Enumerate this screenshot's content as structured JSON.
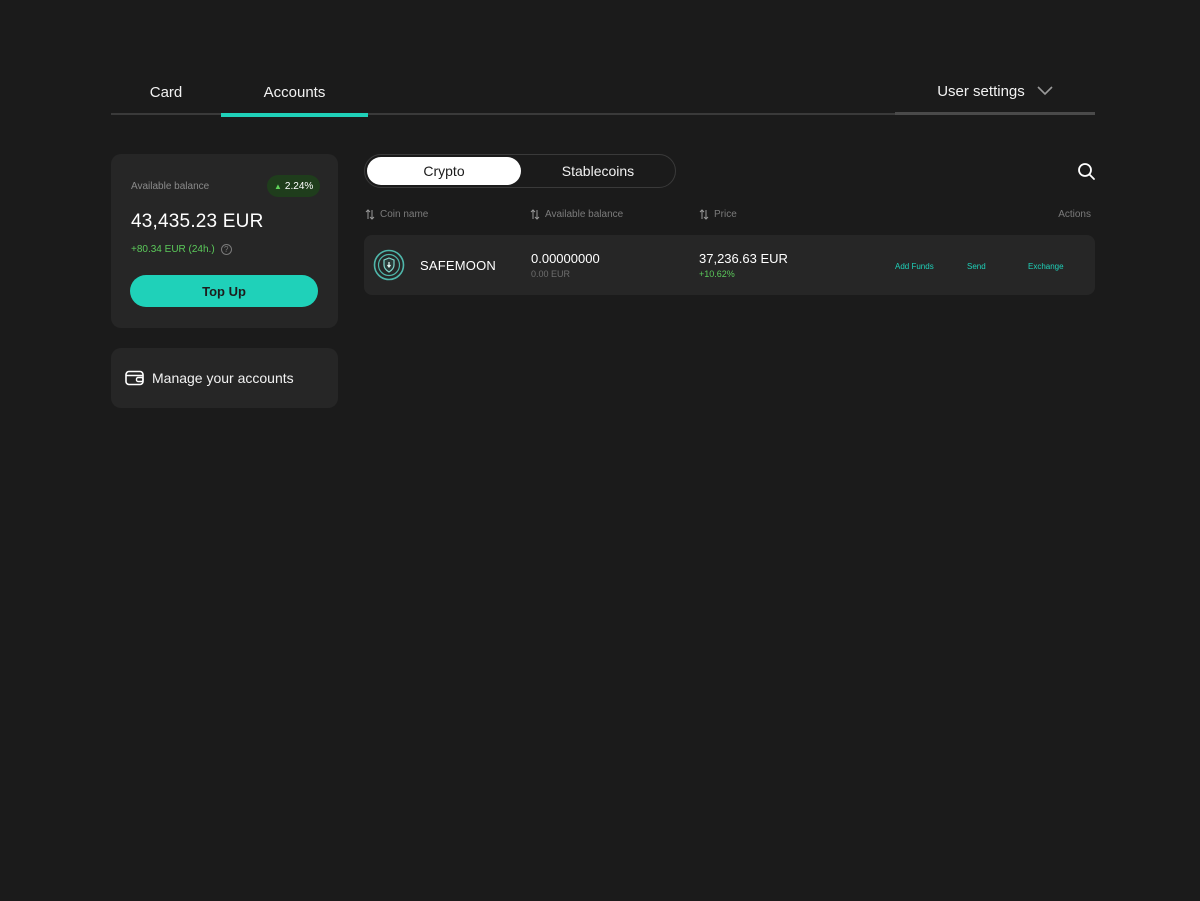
{
  "nav": {
    "tabs": [
      {
        "label": "Card"
      },
      {
        "label": "Accounts",
        "active": true
      }
    ],
    "user_settings": "User settings",
    "accent_color": "#1fd1b9"
  },
  "balance": {
    "label": "Available balance",
    "change_badge": "2.24%",
    "amount": "43,435.23 EUR",
    "change_24h": "+80.34 EUR (24h.)",
    "topup_label": "Top Up"
  },
  "manage": {
    "label": "Manage your accounts",
    "icon": "wallet-icon"
  },
  "segments": {
    "options": [
      "Crypto",
      "Stablecoins"
    ],
    "selected": "Crypto"
  },
  "table": {
    "headers": {
      "coin": "Coin name",
      "available": "Available balance",
      "price": "Price",
      "actions": "Actions"
    },
    "rows": [
      {
        "coin": "SAFEMOON",
        "amount": "0.00000000",
        "amount_fiat": "0.00 EUR",
        "price": "37,236.63 EUR",
        "price_change": "+10.62%",
        "actions": [
          "Add Funds",
          "Send",
          "Exchange"
        ]
      }
    ]
  }
}
